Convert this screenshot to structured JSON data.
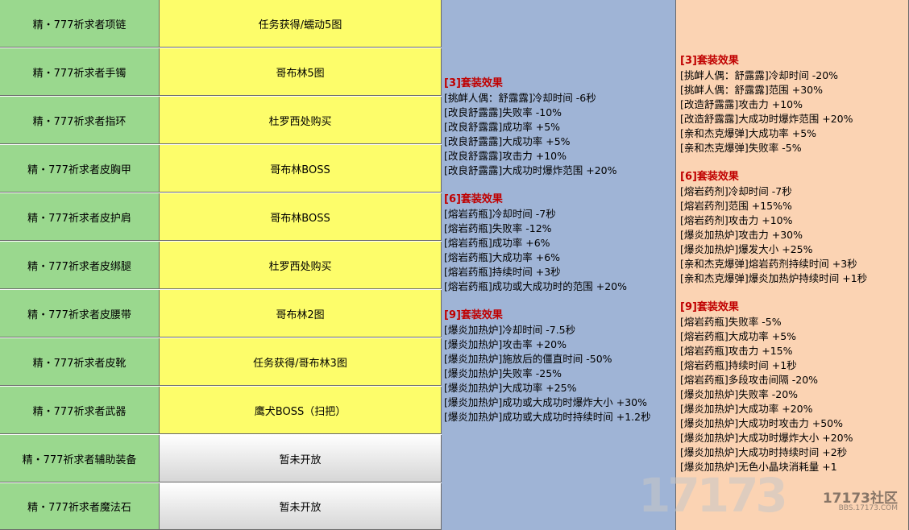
{
  "rows": [
    {
      "name": "精・777祈求者项链",
      "source": "任务获得/蠕动5图"
    },
    {
      "name": "精・777祈求者手镯",
      "source": "哥布林5图"
    },
    {
      "name": "精・777祈求者指环",
      "source": "杜罗西处购买"
    },
    {
      "name": "精・777祈求者皮胸甲",
      "source": "哥布林BOSS"
    },
    {
      "name": "精・777祈求者皮护肩",
      "source": "哥布林BOSS"
    },
    {
      "name": "精・777祈求者皮绑腿",
      "source": "杜罗西处购买"
    },
    {
      "name": "精・777祈求者皮腰带",
      "source": "哥布林2图"
    },
    {
      "name": "精・777祈求者皮靴",
      "source": "任务获得/哥布林3图"
    },
    {
      "name": "精・777祈求者武器",
      "source": "鹰犬BOSS（扫把）"
    },
    {
      "name": "精・777祈求者辅助装备",
      "source": "暂未开放"
    },
    {
      "name": "精・777祈求者魔法石",
      "source": "暂未开放"
    }
  ],
  "set_blue": {
    "set3": {
      "heading": "[3]套装效果",
      "lines": [
        "[挑衅人偶：舒露露]冷却时间 -6秒",
        "[改良舒露露]失败率 -10%",
        "[改良舒露露]成功率 +5%",
        "[改良舒露露]大成功率 +5%",
        "[改良舒露露]攻击力 +10%",
        "[改良舒露露]大成功时爆炸范围 +20%"
      ]
    },
    "set6": {
      "heading": "[6]套装效果",
      "lines": [
        "[熔岩药瓶]冷却时间 -7秒",
        "[熔岩药瓶]失败率 -12%",
        "[熔岩药瓶]成功率 +6%",
        "[熔岩药瓶]大成功率 +6%",
        "[熔岩药瓶]持续时间 +3秒",
        "[熔岩药瓶]成功或大成功时的范围 +20%"
      ]
    },
    "set9": {
      "heading": "[9]套装效果",
      "lines": [
        "[爆炎加热炉]冷却时间 -7.5秒",
        "[爆炎加热炉]攻击率 +20%",
        "[爆炎加热炉]施放后的僵直时间 -50%",
        "[爆炎加热炉]失败率 -25%",
        "[爆炎加热炉]大成功率 +25%",
        "[爆炎加热炉]成功或大成功时爆炸大小 +30%",
        "[爆炎加热炉]成功或大成功时持续时间 +1.2秒"
      ]
    }
  },
  "set_peach": {
    "set3": {
      "heading": "[3]套装效果",
      "lines": [
        "[挑衅人偶：舒露露]冷却时间 -20%",
        "[挑衅人偶：舒露露]范围 +30%",
        "[改造舒露露]攻击力 +10%",
        "[改造舒露露]大成功时爆炸范围 +20%",
        "[亲和杰克爆弹]大成功率 +5%",
        "[亲和杰克爆弹]失败率 -5%"
      ]
    },
    "set6": {
      "heading": "[6]套装效果",
      "lines": [
        "[熔岩药剂]冷却时间 -7秒",
        "[熔岩药剂]范围 +15%%",
        "[熔岩药剂]攻击力 +10%",
        "[爆炎加热炉]攻击力 +30%",
        "[爆炎加热炉]爆发大小 +25%",
        "[亲和杰克爆弹]熔岩药剂持续时间 +3秒",
        "[亲和杰克爆弹]爆炎加热炉持续时间 +1秒"
      ]
    },
    "set9": {
      "heading": "[9]套装效果",
      "lines": [
        "[熔岩药瓶]失败率 -5%",
        "[熔岩药瓶]大成功率 +5%",
        "[熔岩药瓶]攻击力 +15%",
        "[熔岩药瓶]持续时间 +1秒",
        "[熔岩药瓶]多段攻击间隔 -20%",
        "[爆炎加热炉]失败率 -20%",
        "[爆炎加热炉]大成功率 +20%",
        "[爆炎加热炉]大成功时攻击力 +50%",
        "[爆炎加热炉]大成功时爆炸大小 +20%",
        "[爆炎加热炉]大成功时持续时间 +2秒",
        "[爆炎加热炉]无色小晶块消耗量 +1"
      ]
    }
  },
  "watermark": {
    "big": "17173",
    "logo": "17173社区",
    "url": "BBS.17173.COM"
  },
  "colors": {
    "name_bg": "#9ad88e",
    "source_bg": "#fdfd6a",
    "blue_panel": "#9fb4d6",
    "peach_panel": "#fbd3b3",
    "heading": "#c00000"
  }
}
